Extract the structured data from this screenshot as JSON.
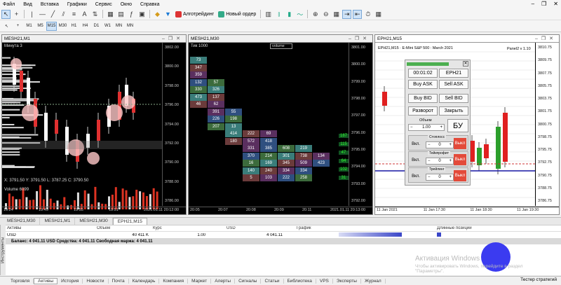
{
  "menu": [
    "Файл",
    "Вид",
    "Вставка",
    "Графики",
    "Сервис",
    "Окно",
    "Справка"
  ],
  "toolbar": {
    "algo": "Алготрейдинг",
    "new_order": "Новый ордер"
  },
  "timeframes": [
    "M1",
    "M5",
    "M15",
    "M30",
    "H1",
    "H4",
    "D1",
    "W1",
    "MN",
    "MN"
  ],
  "charts": [
    {
      "title": "MESH21,M1",
      "header": "Минута  3",
      "prices": [
        "3802.00",
        "3800.00",
        "3798.00",
        "3796.00",
        "3794.00",
        "3792.00",
        "3790.00",
        "3788.00",
        "3786.00"
      ],
      "times": [
        "19:24",
        "19:45",
        "19:55",
        "19:51",
        "2021.01.11 20:12:00"
      ],
      "current": "3791.25",
      "footer": "X: 3791.50  Y: 3791.50  L: 3787.25  C: 3790.50",
      "volume": "Volume 6099",
      "mini": [
        "894",
        "13:54:39",
        "05:01"
      ]
    },
    {
      "title": "MESH21,M30",
      "header": "Тик  1000",
      "indicator": "volume",
      "prices": [
        "3801.00",
        "3800.00",
        "3799.00",
        "3798.00",
        "3797.00",
        "3796.00",
        "3795.00",
        "3794.00",
        "3793.00",
        "3792.00"
      ],
      "times": [
        "20:05",
        "20:07",
        "20:08",
        "20:09",
        "20:11",
        "2021.01.11 20:13:00"
      ],
      "current": "3792.00",
      "side_values": [
        "187",
        "115",
        "47",
        "64",
        "102",
        "31"
      ]
    },
    {
      "title": "EPH21,M15",
      "info": "EPH21,M15 · E-Mini S&P 500 : March 2021",
      "panel": "Panel2 v 1.10",
      "prices": [
        "3810.75",
        "3809.75",
        "3807.75",
        "3805.75",
        "3803.75",
        "3801.75",
        "3800.75",
        "3798.75",
        "3795.75",
        "3792.75",
        "3790.75",
        "3788.75",
        "3786.75"
      ],
      "times": [
        "11 Jan 2021",
        "11 Jan 17:30",
        "11 Jan 18:30",
        "11 Jan 19:30"
      ],
      "current": "3790.50"
    }
  ],
  "footprint": [
    [
      "73"
    ],
    [
      "347"
    ],
    [
      "359"
    ],
    [
      "132",
      "57"
    ],
    [
      "330",
      "326"
    ],
    [
      "473",
      "137"
    ],
    [
      "46",
      "62"
    ],
    [
      "391",
      "55"
    ],
    [
      "226",
      "198"
    ],
    [
      "207",
      "13"
    ],
    [
      "414",
      "222",
      "69"
    ],
    [
      "180",
      "572",
      "418"
    ],
    [
      "331",
      "385",
      "608",
      "219"
    ],
    [
      "370",
      "214",
      "301",
      "738",
      "134"
    ],
    [
      "16",
      "169",
      "345",
      "509",
      "423"
    ],
    [
      "140",
      "240",
      "334",
      "334"
    ],
    [
      "5",
      "103",
      "222",
      "258"
    ]
  ],
  "panel": {
    "time": "00:01:02",
    "symbol": "EPH21",
    "buy_ask": "Buy ASK",
    "sell_ask": "Sell ASK",
    "buy_bid": "Buy BID",
    "sell_bid": "Sell BID",
    "reverse": "Разворот",
    "close": "Закрыть",
    "volume_label": "Объем",
    "volume": "1.00",
    "bu": "БУ",
    "stoploss": "Стоплосс",
    "takeprofit": "Тейкпрофит",
    "trailing": "Трейлинг",
    "on": "Вкл.",
    "off": "Выкл",
    "zero": "0"
  },
  "chart_tabs": [
    "MESH21,M30",
    "MESH21,M1",
    "MESH21,M30",
    "EPH21,M15"
  ],
  "terminal": {
    "headers": [
      "Активы",
      "Объем",
      "Курс",
      "USD",
      "График",
      "Длинные позиции"
    ],
    "row": [
      "USD",
      "40 411 K",
      "1.00",
      "4 041.11"
    ],
    "balance": "Баланс: 4 041.11 USD  Средства: 4 041.11  Свободная маржа: 4 041.11",
    "side": "Инструменты"
  },
  "bottom_tabs": [
    "Торговля",
    "Активы",
    "История",
    "Новости",
    "Почта",
    "Календарь",
    "Компания",
    "Маркет",
    "Алерты",
    "Сигналы",
    "Статьи",
    "Библиотека",
    "VPS",
    "Эксперты",
    "Журнал"
  ],
  "tester": "Тестер стратегий",
  "watermark": {
    "title": "Активация Windows",
    "text": "Чтобы активировать Windows, перейдите в раздел \"Параметры\"."
  }
}
